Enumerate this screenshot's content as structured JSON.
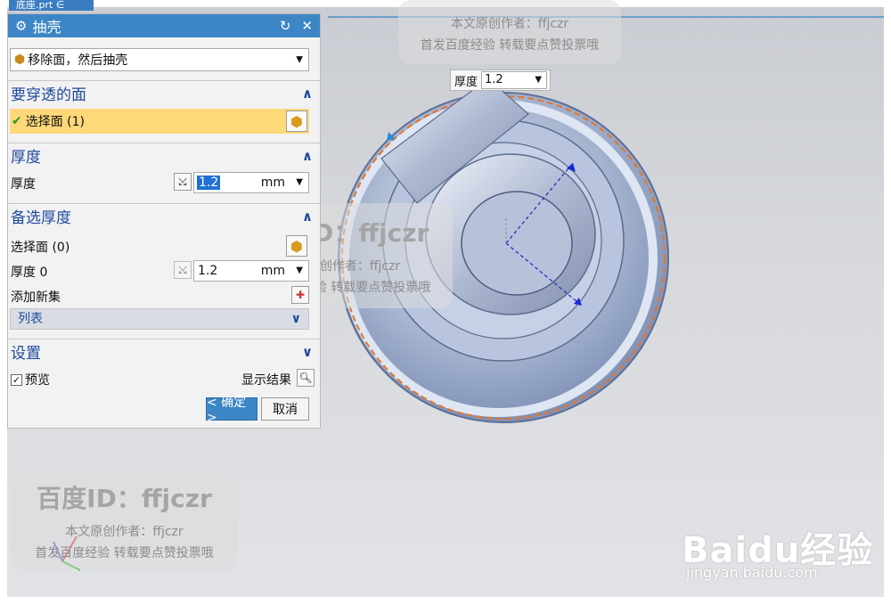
{
  "file_tab": {
    "label": "底座.prt ∈"
  },
  "dialog": {
    "title": "抽壳",
    "reset_icon": "reset-icon",
    "close_icon": "close-icon",
    "type_combo": {
      "value": "移除面，然后抽壳"
    },
    "faces_section": {
      "title": "要穿透的面",
      "select_label": "选择面 (1)"
    },
    "thickness_section": {
      "title": "厚度",
      "label": "厚度",
      "value": "1.2",
      "unit": "mm"
    },
    "alt_section": {
      "title": "备选厚度",
      "select_label": "选择面 (0)",
      "thickness_label": "厚度 0",
      "value": "1.2",
      "unit": "mm",
      "add_set_label": "添加新集",
      "list_label": "列表"
    },
    "settings_section": {
      "title": "设置",
      "preview_label": "预览",
      "show_result_label": "显示结果"
    },
    "ok_label": "< 确定 >",
    "cancel_label": "取消"
  },
  "float_label": {
    "label": "厚度",
    "value": "1.2"
  },
  "watermarks": {
    "id_text": "百度ID：ffjczr",
    "author_text": "本文原创作者：ffjczr",
    "note_text": "首发百度经验 转载要点赞投票哦"
  },
  "baidu": {
    "logo": "Baidu经验",
    "url": "jingyan.baidu.com"
  },
  "colors": {
    "title_bar": "#3c86c6",
    "selected_row": "#fed97a",
    "section_text": "#1f4a9c",
    "ok_button": "#3c86c6"
  }
}
